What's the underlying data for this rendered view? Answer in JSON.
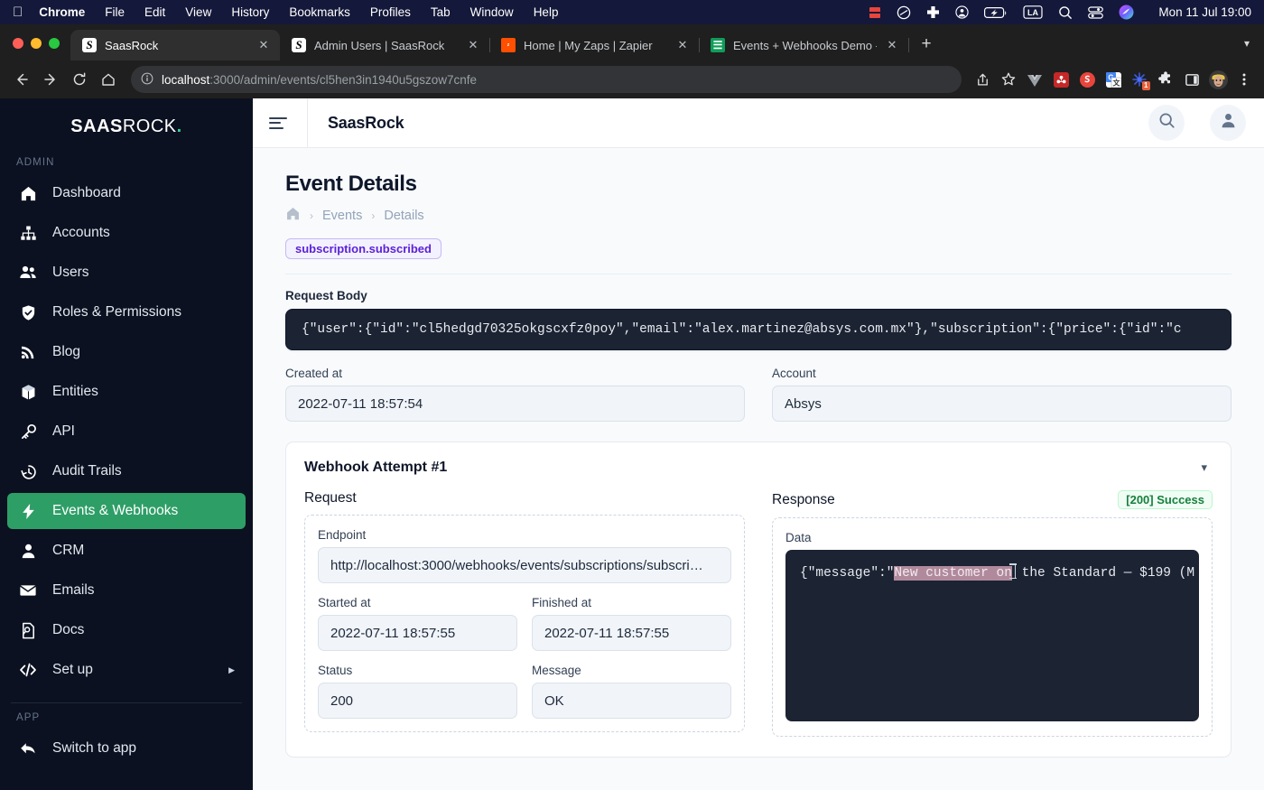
{
  "os": {
    "apple_logo": "apple-logo",
    "menus": [
      "Chrome",
      "File",
      "Edit",
      "View",
      "History",
      "Bookmarks",
      "Profiles",
      "Tab",
      "Window",
      "Help"
    ],
    "tray_icons": [
      "recording-icon",
      "no-entry-icon",
      "plus-cross-icon",
      "user-circle-icon",
      "battery-charging-icon",
      "la-keyboard-icon",
      "spotlight-search-icon",
      "control-center-icon",
      "siri-icon"
    ],
    "clock": "Mon 11 Jul  19:00"
  },
  "browser": {
    "tabs": [
      {
        "title": "SaasRock",
        "favicon": "saasrock-favicon",
        "active": true
      },
      {
        "title": "Admin Users | SaasRock",
        "favicon": "saasrock-favicon",
        "active": false
      },
      {
        "title": "Home | My Zaps | Zapier",
        "favicon": "zapier-favicon",
        "active": false
      },
      {
        "title": "Events + Webhooks Demo - Ho",
        "favicon": "google-sheets-favicon",
        "active": false
      }
    ],
    "new_tab_label": "+",
    "url_host": "localhost",
    "url_path": ":3000/admin/events/cl5hen3in1940u5gszow7cnfe",
    "extensions": [
      "share-icon",
      "bookmark-star-icon",
      "vue-devtools-icon",
      "red-extension-icon",
      "s-extension-icon",
      "google-translate-icon",
      "blue-star-extension-icon",
      "puzzle-extensions-icon",
      "side-panel-icon",
      "profile-avatar-icon",
      "chrome-menu-icon"
    ],
    "extension_badge_count": "1"
  },
  "sidebar": {
    "logo_bold": "SAAS",
    "logo_normal": "ROCK",
    "logo_dot": ".",
    "sections": [
      {
        "label": "ADMIN",
        "items": [
          {
            "label": "Dashboard",
            "icon": "home-icon",
            "active": false
          },
          {
            "label": "Accounts",
            "icon": "org-chart-icon",
            "active": false
          },
          {
            "label": "Users",
            "icon": "users-icon",
            "active": false
          },
          {
            "label": "Roles & Permissions",
            "icon": "shield-check-icon",
            "active": false
          },
          {
            "label": "Blog",
            "icon": "rss-icon",
            "active": false
          },
          {
            "label": "Entities",
            "icon": "cube-icon",
            "active": false
          },
          {
            "label": "API",
            "icon": "key-icon",
            "active": false
          },
          {
            "label": "Audit Trails",
            "icon": "clock-history-icon",
            "active": false
          },
          {
            "label": "Events & Webhooks",
            "icon": "lightning-bolt-icon",
            "active": true
          },
          {
            "label": "CRM",
            "icon": "person-icon",
            "active": false
          },
          {
            "label": "Emails",
            "icon": "envelope-icon",
            "active": false
          },
          {
            "label": "Docs",
            "icon": "document-search-icon",
            "active": false
          },
          {
            "label": "Set up",
            "icon": "code-brackets-icon",
            "active": false,
            "caret": "▶"
          }
        ]
      },
      {
        "label": "APP",
        "items": [
          {
            "label": "Switch to app",
            "icon": "arrow-back-icon",
            "active": false
          }
        ]
      }
    ]
  },
  "topbar": {
    "menu_toggle": "sidebar-toggle-icon",
    "title": "SaasRock",
    "search_icon": "search-icon",
    "account_icon": "account-avatar-icon"
  },
  "page": {
    "title": "Event Details",
    "breadcrumb": {
      "home_icon": "home-icon",
      "items": [
        "Events",
        "Details"
      ],
      "separator": "›"
    },
    "event_badge": "subscription.subscribed",
    "request_body_label": "Request Body",
    "request_body": "{\"user\":{\"id\":\"cl5hedgd70325okgscxfz0poy\",\"email\":\"alex.martinez@absys.com.mx\"},\"subscription\":{\"price\":{\"id\":\"c",
    "created_at_label": "Created at",
    "created_at_value": "2022-07-11 18:57:54",
    "account_label": "Account",
    "account_value": "Absys"
  },
  "attempt": {
    "title": "Webhook Attempt #1",
    "collapse_icon": "chevron-down-icon",
    "request": {
      "title": "Request",
      "endpoint_label": "Endpoint",
      "endpoint_value": "http://localhost:3000/webhooks/events/subscriptions/subscri…",
      "started_at_label": "Started at",
      "started_at_value": "2022-07-11 18:57:55",
      "finished_at_label": "Finished at",
      "finished_at_value": "2022-07-11 18:57:55",
      "status_label": "Status",
      "status_value": "200",
      "message_label": "Message",
      "message_value": "OK"
    },
    "response": {
      "title": "Response",
      "status_badge": "[200] Success",
      "data_label": "Data",
      "data_prefix": "{\"message\":\"",
      "data_selected": "New customer on",
      "data_suffix": " the Standard — $199 (M"
    }
  },
  "colors": {
    "accent_green": "#2e9e67",
    "sidebar_bg": "#0b1120",
    "badge_purple": "#5b21d6",
    "success_green": "#15803d",
    "code_bg": "#1c2333",
    "selection_highlight": "#b08a9c"
  }
}
